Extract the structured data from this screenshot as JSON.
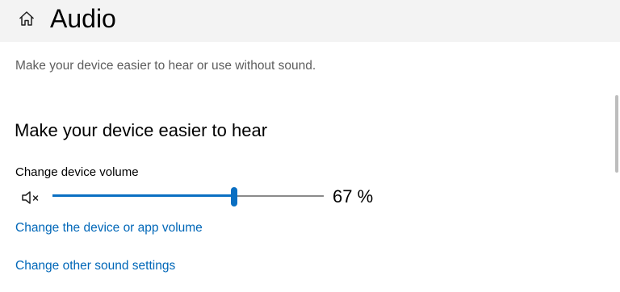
{
  "header": {
    "title": "Audio",
    "home_icon": "home-icon"
  },
  "description": "Make your device easier to hear or use without sound.",
  "section": {
    "heading": "Make your device easier to hear",
    "volume": {
      "label": "Change device volume",
      "mute_icon": "speaker-muted-icon",
      "level_percent": 67,
      "value_text": "67 %"
    },
    "links": [
      "Change the device or app volume",
      "Change other sound settings"
    ]
  },
  "colors": {
    "accent": "#0a6fc2",
    "link": "#0067b8",
    "header_bg": "#f3f3f3",
    "secondary_text": "#5d5d5d"
  }
}
